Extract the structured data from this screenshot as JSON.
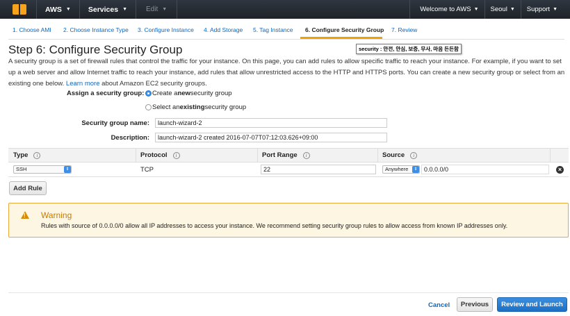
{
  "topnav": {
    "logo_icon": "aws-cube-icon",
    "aws_label": "AWS",
    "services_label": "Services",
    "edit_label": "Edit",
    "welcome_label": "Welcome to AWS",
    "region_label": "Seoul",
    "support_label": "Support"
  },
  "wizard": {
    "tabs": [
      {
        "label": "1. Choose AMI"
      },
      {
        "label": "2. Choose Instance Type"
      },
      {
        "label": "3. Configure Instance"
      },
      {
        "label": "4. Add Storage"
      },
      {
        "label": "5. Tag Instance"
      },
      {
        "label": "6. Configure Security Group"
      },
      {
        "label": "7. Review"
      }
    ],
    "active_index": 5
  },
  "page": {
    "title": "Step 6: Configure Security Group",
    "tooltip": "security : 안전, 안심, 보증, 무사, 마음 든든함",
    "description_before_link": "A security group is a set of firewall rules that control the traffic for your instance. On this page, you can add rules to allow specific traffic to reach your instance. For example, if you want to set up a web server and allow Internet traffic to reach your instance, add rules that allow unrestricted access to the HTTP and HTTPS ports. You can create a new security group or select from an existing one below.",
    "learn_more": "Learn more",
    "description_after_link": "about Amazon EC2 security groups."
  },
  "form": {
    "assign_label": "Assign a security group:",
    "option_new_prefix": "Create a ",
    "option_new_bold": "new",
    "option_new_suffix": " security group",
    "option_existing_prefix": "Select an ",
    "option_existing_bold": "existing",
    "option_existing_suffix": " security group",
    "selected_option": "new",
    "name_label": "Security group name:",
    "name_value": "launch-wizard-2",
    "desc_label": "Description:",
    "desc_value": "launch-wizard-2 created 2016-07-07T07:12:03.626+09:00"
  },
  "rules": {
    "headers": {
      "type": "Type",
      "protocol": "Protocol",
      "port_range": "Port Range",
      "source": "Source",
      "info_glyph": "i"
    },
    "rows": [
      {
        "type": "SSH",
        "protocol": "TCP",
        "port_range": "22",
        "source_select": "Anywhere",
        "source_cidr": "0.0.0.0/0"
      }
    ],
    "add_rule_label": "Add Rule"
  },
  "warning": {
    "title": "Warning",
    "text": "Rules with source of 0.0.0.0/0 allow all IP addresses to access your instance. We recommend setting security group rules to allow access from known IP addresses only.",
    "icon": "warning-triangle-icon",
    "color": "#e8a93a"
  },
  "footer": {
    "cancel_label": "Cancel",
    "previous_label": "Previous",
    "review_label": "Review and Launch"
  },
  "colors": {
    "nav_bg": "#232f3e",
    "link": "#1166bb",
    "primary": "#2a7bd2",
    "active_tab_underline": "#f0a202"
  }
}
